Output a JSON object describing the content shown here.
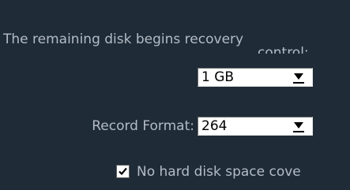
{
  "recovery": {
    "label_line1": "The remaining disk begins recovery",
    "label_line2": "control:",
    "selected": "1 GB"
  },
  "format": {
    "label": "Record Format:",
    "selected": "264"
  },
  "no_space": {
    "label": "No hard disk space cove",
    "checked": true
  },
  "icons": {
    "dropdown": "chevron-down-icon",
    "check": "checkmark-icon"
  }
}
